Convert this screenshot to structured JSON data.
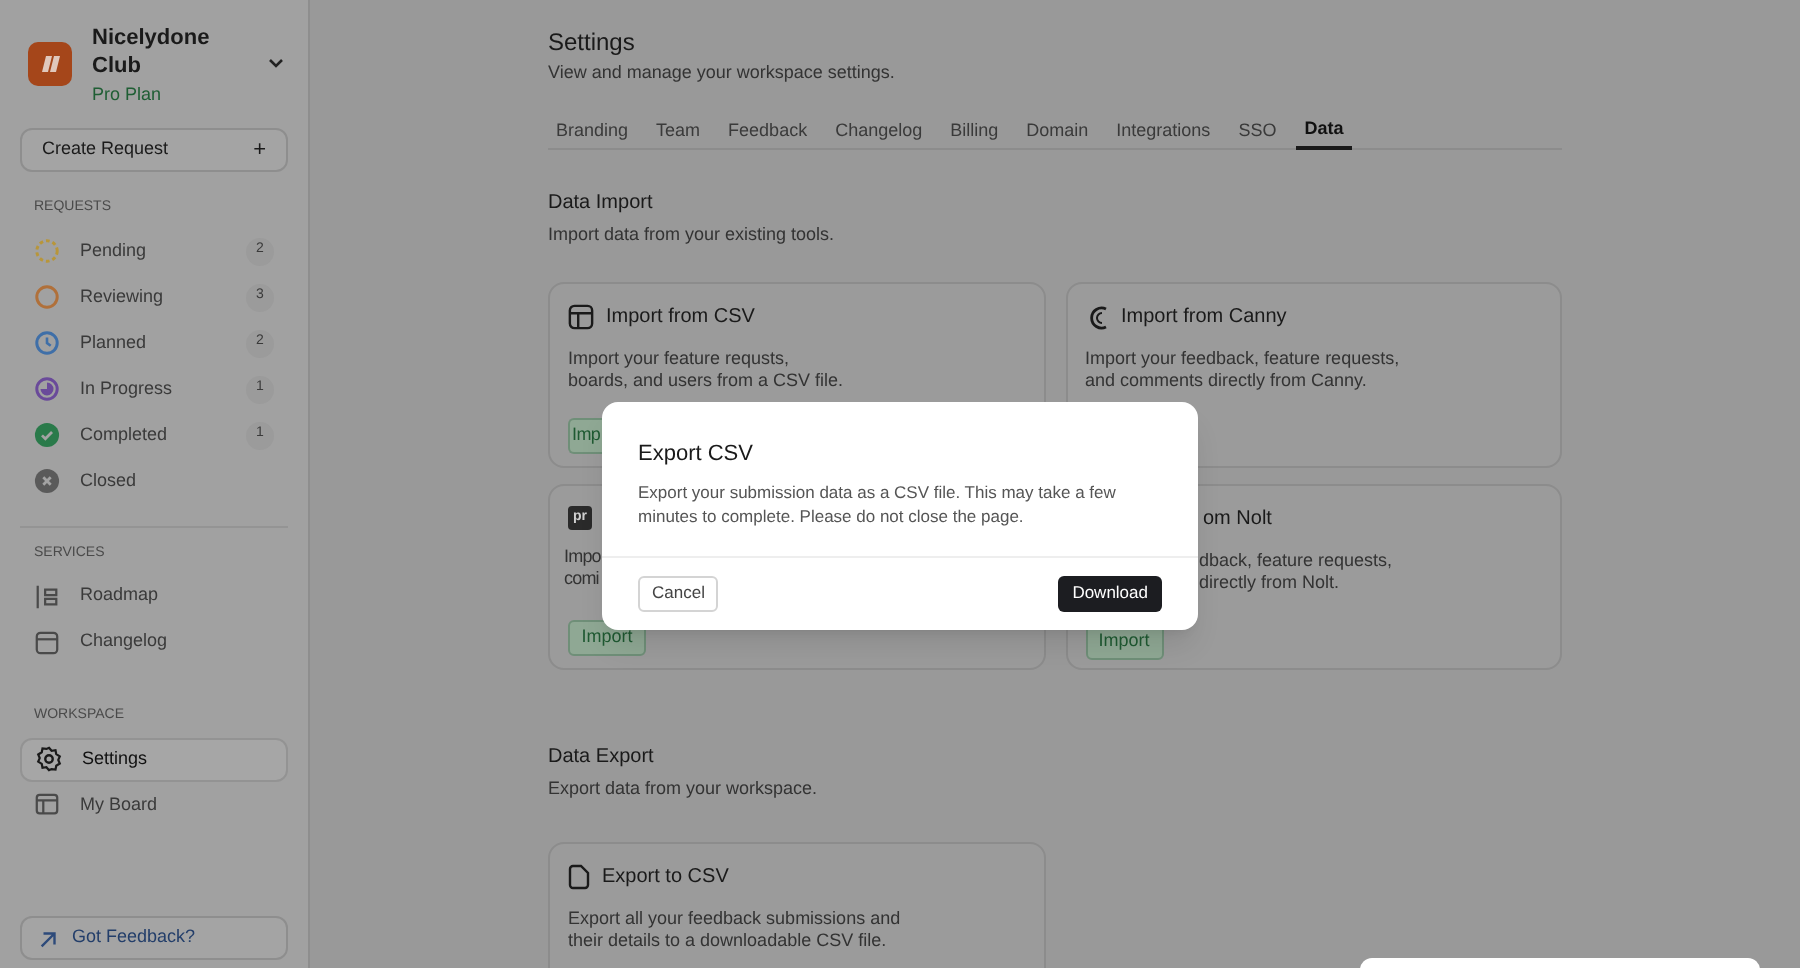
{
  "workspace": {
    "name": "Nicelydone Club",
    "plan": "Pro Plan"
  },
  "create_button": {
    "label": "Create Request",
    "icon": "+"
  },
  "sidebar": {
    "sections": [
      {
        "title": "REQUESTS",
        "items": [
          {
            "label": "Pending",
            "count": "2",
            "kind": "pending",
            "color": "#b8963a",
            "selected": false
          },
          {
            "label": "Reviewing",
            "count": "3",
            "kind": "reviewing",
            "color": "#b0703a",
            "selected": false
          },
          {
            "label": "Planned",
            "count": "2",
            "kind": "planned",
            "color": "#3f6fa8",
            "selected": false
          },
          {
            "label": "In Progress",
            "count": "1",
            "kind": "progress",
            "color": "#6a4a9a",
            "selected": false
          },
          {
            "label": "Completed",
            "count": "1",
            "kind": "completed",
            "color": "#2a7a4a",
            "selected": false
          },
          {
            "label": "Closed",
            "kind": "closed",
            "color": "#5a5a5a",
            "selected": false
          }
        ]
      },
      {
        "title": "SERVICES",
        "items": [
          {
            "label": "Roadmap",
            "kind": "roadmap",
            "selected": false
          },
          {
            "label": "Changelog",
            "kind": "changelog",
            "selected": false
          }
        ]
      },
      {
        "title": "WORKSPACE",
        "items": [
          {
            "label": "Settings",
            "kind": "settings",
            "selected": true
          },
          {
            "label": "My Board",
            "kind": "board",
            "selected": false
          }
        ]
      }
    ]
  },
  "feedback_button": {
    "label": "Got Feedback?"
  },
  "page": {
    "title": "Settings",
    "subtitle": "View and manage your workspace settings."
  },
  "tabs": [
    {
      "label": "Branding",
      "selected": false
    },
    {
      "label": "Team",
      "selected": false
    },
    {
      "label": "Feedback",
      "selected": false
    },
    {
      "label": "Changelog",
      "selected": false
    },
    {
      "label": "Billing",
      "selected": false
    },
    {
      "label": "Domain",
      "selected": false
    },
    {
      "label": "Integrations",
      "selected": false
    },
    {
      "label": "SSO",
      "selected": false
    },
    {
      "label": "Data",
      "selected": true
    }
  ],
  "import_section": {
    "title": "Data Import",
    "subtitle": "Import data from your existing tools.",
    "cards": [
      {
        "title": "Import from CSV",
        "description": [
          "Import your feature requsts,",
          "boards, and users from a CSV file."
        ],
        "button": "Imp"
      },
      {
        "title": "Import from Canny",
        "description": [
          "Import your feedback, feature requests,",
          "and comments directly from Canny."
        ]
      },
      {
        "icon_text": "pr",
        "description": [
          "Impo",
          "comi"
        ],
        "button": "Import"
      },
      {
        "title": "om Nolt",
        "description": [
          "dback, feature requests,",
          "directly from Nolt."
        ],
        "button": "Import"
      }
    ]
  },
  "export_section": {
    "title": "Data Export",
    "subtitle": "Export data from your workspace.",
    "card": {
      "title": "Export to CSV",
      "description": [
        "Export all your feedback submissions and",
        "their details to a downloadable CSV file."
      ]
    }
  },
  "modal": {
    "title": "Export CSV",
    "message": "Export your submission data as a CSV file. This may take a few minutes to complete. Please do not close the page.",
    "cancel": "Cancel",
    "confirm": "Download"
  }
}
